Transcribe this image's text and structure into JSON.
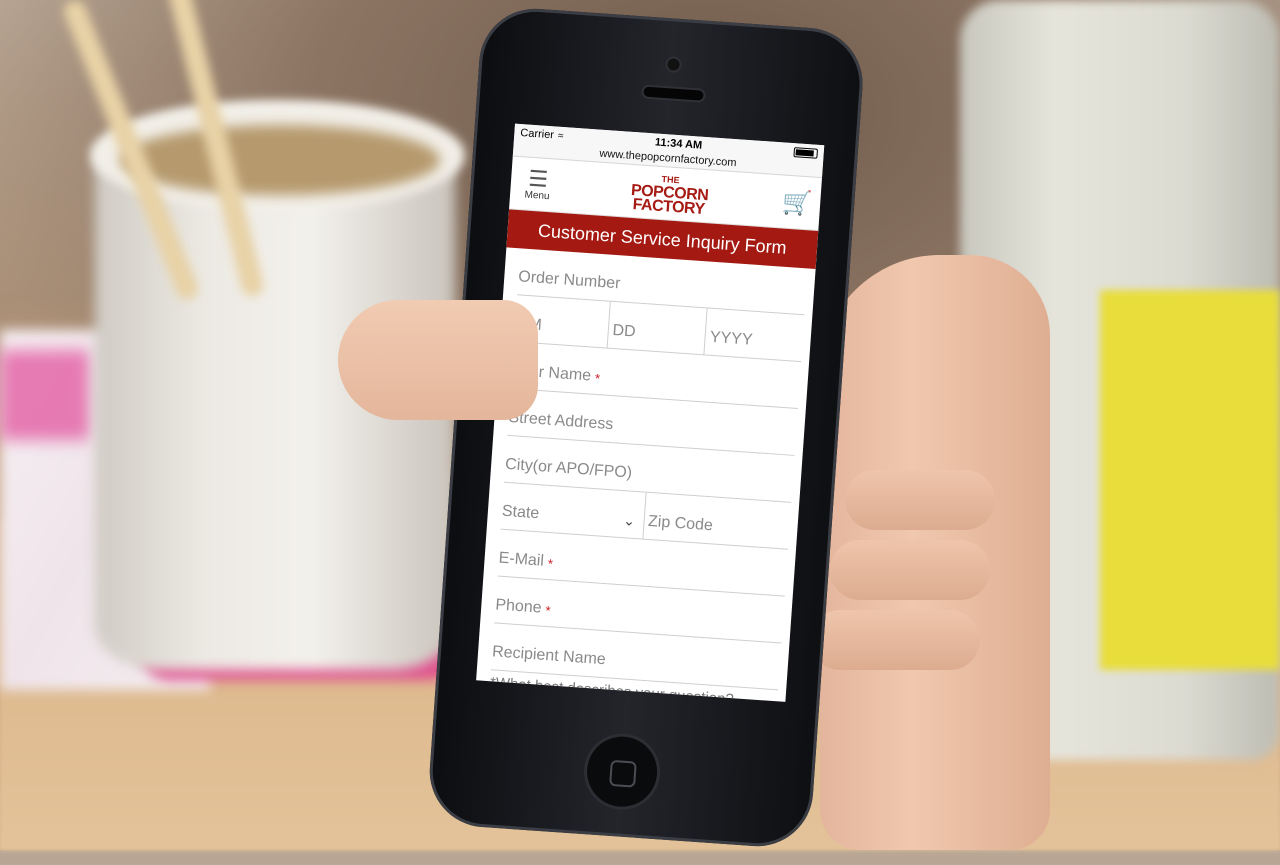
{
  "statusbar": {
    "carrier": "Carrier",
    "time": "11:34 AM"
  },
  "browser": {
    "url": "www.thepopcornfactory.com"
  },
  "header": {
    "menu_label": "Menu",
    "logo": {
      "top": "THE",
      "middle": "POPCORN",
      "bottom": "FACTORY"
    }
  },
  "form": {
    "title": "Customer Service Inquiry Form",
    "order_number": "Order Number",
    "date": {
      "month": "MM",
      "day": "DD",
      "year": "YYYY"
    },
    "your_name": "Your Name",
    "street_address": "Street Address",
    "city": "City(or APO/FPO)",
    "state": "State",
    "zip_code": "Zip Code",
    "email": "E-Mail",
    "phone": "Phone",
    "recipient_name": "Recipient Name",
    "question_prompt": "*What best describes your question?",
    "required_marker": "*"
  },
  "colors": {
    "brand_red": "#a41a12",
    "required_red": "#c8161d"
  }
}
